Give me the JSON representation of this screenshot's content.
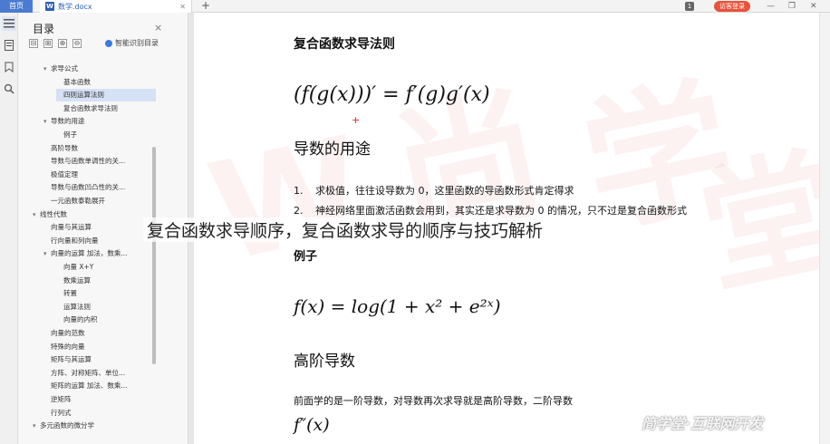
{
  "tabs": {
    "home": "首页",
    "doc_name": "数学.docx",
    "new_tab": "+"
  },
  "topbar": {
    "badge": "1",
    "login": "访客登录",
    "minimize": "—",
    "maximize": "❐",
    "close": "✕"
  },
  "toc_panel": {
    "title": "目录",
    "close": "×",
    "tools": [
      "⊟",
      "⊞",
      "⊕",
      "⊖"
    ],
    "smart_label": "智能识别目录",
    "items": [
      {
        "label": "求导公式",
        "level": 2,
        "caret": "▾"
      },
      {
        "label": "基本函数",
        "level": 3,
        "caret": ""
      },
      {
        "label": "四则运算法则",
        "level": 3,
        "caret": "",
        "selected": true
      },
      {
        "label": "复合函数求导法则",
        "level": 3,
        "caret": ""
      },
      {
        "label": "导数的用途",
        "level": 2,
        "caret": "▾"
      },
      {
        "label": "例子",
        "level": 3,
        "caret": ""
      },
      {
        "label": "高阶导数",
        "level": 2,
        "caret": ""
      },
      {
        "label": "导数与函数单调性的关...",
        "level": 2,
        "caret": ""
      },
      {
        "label": "极值定理",
        "level": 2,
        "caret": ""
      },
      {
        "label": "导数与函数凹凸性的关...",
        "level": 2,
        "caret": ""
      },
      {
        "label": "一元函数泰勒展开",
        "level": 2,
        "caret": ""
      },
      {
        "label": "线性代数",
        "level": 1,
        "caret": "▾"
      },
      {
        "label": "向量与其运算",
        "level": 2,
        "caret": ""
      },
      {
        "label": "行向量和列向量",
        "level": 2,
        "caret": ""
      },
      {
        "label": "向量的运算 加法，数乘...",
        "level": 2,
        "caret": "▾"
      },
      {
        "label": "向量 X+Y",
        "level": 3,
        "caret": ""
      },
      {
        "label": "数乘运算",
        "level": 3,
        "caret": ""
      },
      {
        "label": "转置",
        "level": 3,
        "caret": ""
      },
      {
        "label": "运算法则",
        "level": 3,
        "caret": ""
      },
      {
        "label": "向量的内积",
        "level": 3,
        "caret": ""
      },
      {
        "label": "向量的范数",
        "level": 2,
        "caret": ""
      },
      {
        "label": "特殊的向量",
        "level": 2,
        "caret": ""
      },
      {
        "label": "矩阵与其运算",
        "level": 2,
        "caret": ""
      },
      {
        "label": "方阵、对称矩阵、单位...",
        "level": 2,
        "caret": ""
      },
      {
        "label": "矩阵的运算 加法、数乘...",
        "level": 2,
        "caret": ""
      },
      {
        "label": "逆矩阵",
        "level": 2,
        "caret": ""
      },
      {
        "label": "行列式",
        "level": 2,
        "caret": ""
      },
      {
        "label": "多元函数的微分学",
        "level": 1,
        "caret": "▾"
      }
    ]
  },
  "document": {
    "heading_rule": "复合函数求导法则",
    "formula_chain": "(f(g(x)))′ = f′(g)g′(x)",
    "heading_usage": "导数的用途",
    "list": [
      {
        "num": "1.",
        "text": "求极值，往往设导数为 0，这里函数的导函数形式肯定得求"
      },
      {
        "num": "2.",
        "text": "神经网络里面激活函数会用到，其实还是求导数为 0 的情况，只不过是复合函数形式"
      }
    ],
    "heading_example": "例子",
    "formula_example": "f(x) = log(1 + x² + e²ˣ)",
    "heading_higher": "高阶导数",
    "higher_text": "前面学的是一阶导数，对导数再次求导就是高阶导数，二阶导数",
    "formula_second": "f″(x)"
  },
  "overlay_title": "复合函数求导顺序，复合函数求导的顺序与技巧解析",
  "brand_watermark": "简学堂·互联网开发",
  "colors": {
    "accent": "#4a7bd0",
    "login": "#e8533c",
    "selection": "#d5e1f5"
  }
}
